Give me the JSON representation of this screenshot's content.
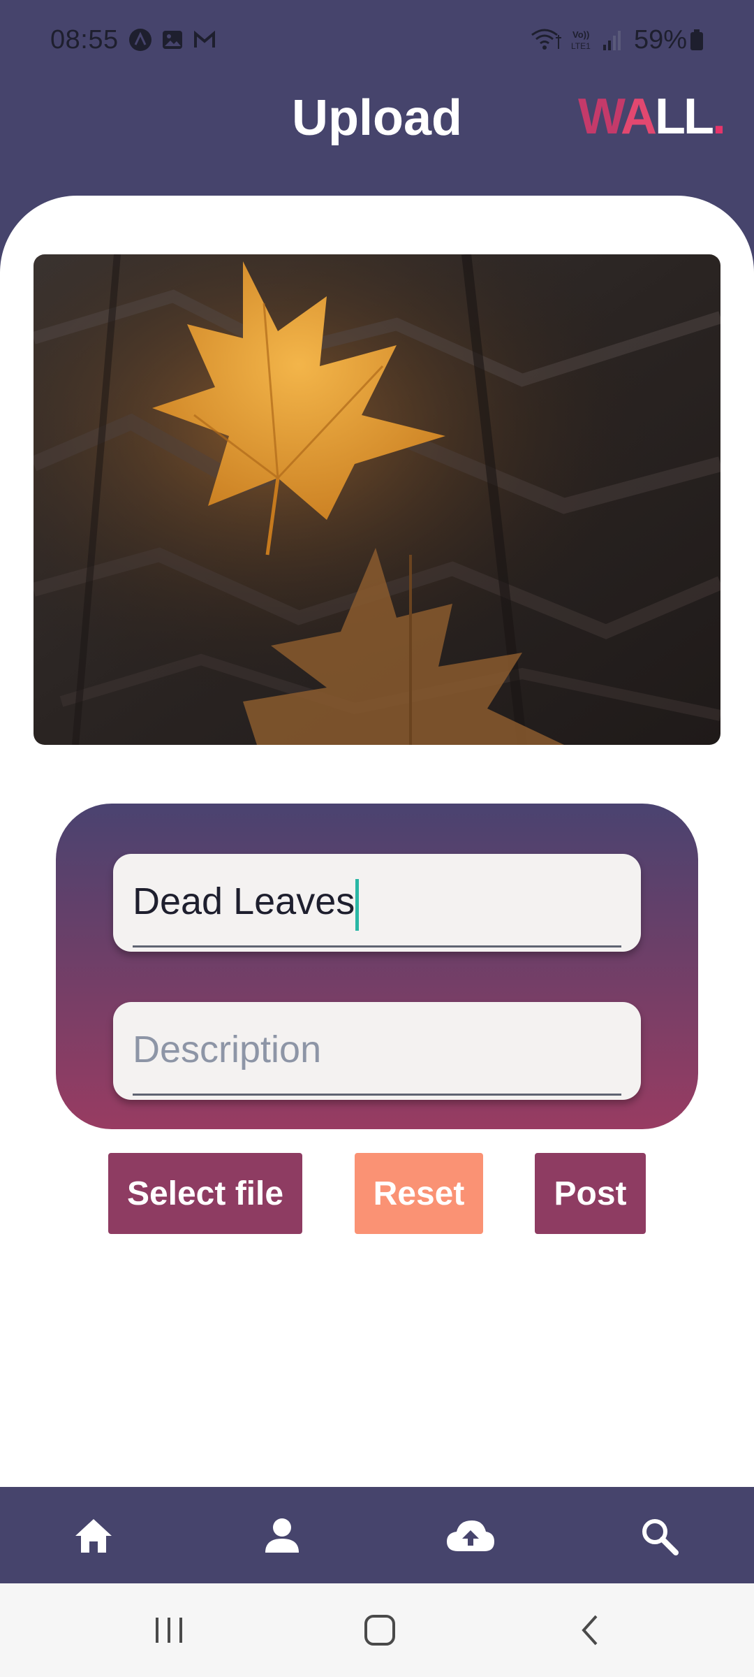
{
  "status_bar": {
    "time": "08:55",
    "battery": "59%",
    "icons": [
      "app-a-icon",
      "gallery-icon",
      "gmail-icon",
      "wifi-calling-icon",
      "volte-icon",
      "signal-icon",
      "battery-icon"
    ]
  },
  "header": {
    "title": "Upload",
    "logo": {
      "w": "W",
      "a": "A",
      "ll": "LL",
      "dot": "."
    }
  },
  "image": {
    "subject": "autumn leaf on tree bark photo"
  },
  "form": {
    "title_value": "Dead Leaves",
    "description_placeholder": "Description",
    "description_value": ""
  },
  "buttons": {
    "select_file": "Select file",
    "reset": "Reset",
    "post": "Post"
  },
  "bottom_nav": {
    "items": [
      "home-icon",
      "profile-icon",
      "upload-cloud-icon",
      "search-icon"
    ]
  },
  "system_nav": {
    "items": [
      "recents-icon",
      "home-button-icon",
      "back-icon"
    ]
  },
  "colors": {
    "header": "#46446c",
    "accent": "#8e3c62",
    "reset": "#fa9274",
    "caret": "#2ab7a5"
  }
}
